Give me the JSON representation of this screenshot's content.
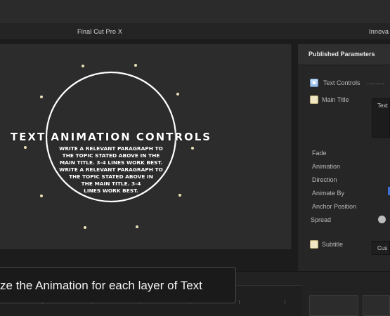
{
  "app": {
    "tabs": [
      {
        "label": "Final Cut Pro X"
      },
      {
        "label": "Innova"
      }
    ]
  },
  "viewer": {
    "title": "TEXT ANIMATION CONTROLS",
    "paragraph": "WRITE A RELEVANT PARAGRAPH TO\nTHE TOPIC STATED ABOVE IN THE\nMAIN TITLE. 3-4 LINES WORK BEST.\nWRITE A RELEVANT PARAGRAPH TO\nTHE TOPIC STATED ABOVE IN\nTHE MAIN TITLE. 3-4\nLINES WORK BEST."
  },
  "inspector": {
    "header": "Published Parameters",
    "text_controls": "Text Controls",
    "text_controls_dots": "..........",
    "main_title": "Main Title",
    "main_title_value": "Text",
    "params": [
      "Fade",
      "Animation",
      "Direction",
      "Animate By",
      "Anchor Position",
      "Spread"
    ],
    "subtitle": "Subtitle",
    "subtitle_value": "Cus"
  },
  "caption": {
    "text": "ze the Animation for each layer of Text"
  },
  "colors": {
    "accent": "#3a6fd6",
    "ring": "#ffffff",
    "star_dots": "#e8e2b8"
  }
}
